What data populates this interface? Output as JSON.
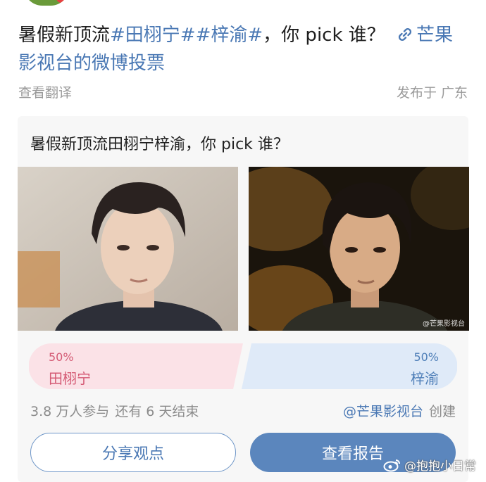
{
  "post": {
    "prefix": "暑假新顶流",
    "topic_1": "#田栩宁#",
    "topic_2": "#梓渝#",
    "middle": "，你 pick 谁？",
    "link_text": "芒果影视台的微博投票",
    "translate": "查看翻译",
    "location": "发布于 广东"
  },
  "poll": {
    "title": "暑假新顶流田栩宁梓渝，你 pick 谁？",
    "options": [
      {
        "name": "田栩宁",
        "percent": "50%"
      },
      {
        "name": "梓渝",
        "percent": "50%"
      }
    ],
    "participants": "3.8 万人参与",
    "remaining": "还有 6 天结束",
    "creator_handle": "@芒果影视台",
    "creator_suffix": "创建",
    "share_label": "分享观点",
    "report_label": "查看报告",
    "photo_watermark": "@芒果影视台"
  },
  "watermark": "@抱抱小日常",
  "colors": {
    "link": "#4a78b4",
    "option_a_bg": "#fbe2e7",
    "option_a_text": "#d45a74",
    "option_b_bg": "#dfeaf8",
    "option_b_text": "#4f7fb8",
    "primary_button": "#5b86bd"
  },
  "icons": [
    "link-icon",
    "weibo-logo-icon"
  ]
}
